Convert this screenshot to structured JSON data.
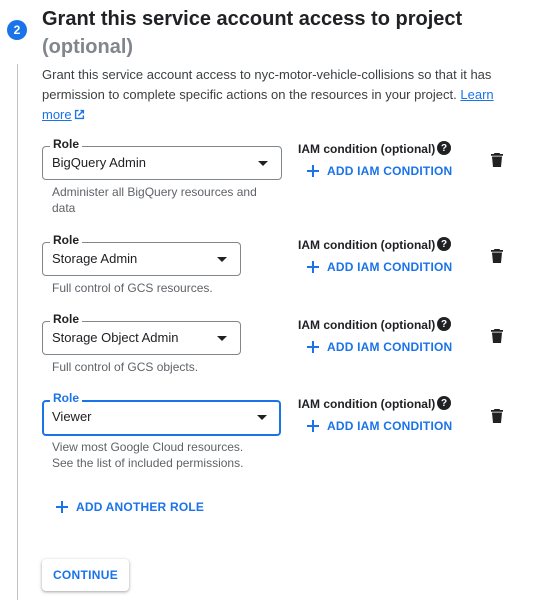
{
  "step": {
    "number": "2",
    "title_main": "Grant this service account access to project",
    "title_optional": "(optional)"
  },
  "description": {
    "text": "Grant this service account access to nyc-motor-vehicle-collisions so that it has permission to complete specific actions on the resources in your project.",
    "learn_more": "Learn more",
    "learn_more_icon": "external-link-icon"
  },
  "role_label": "Role",
  "iam_condition_label": "IAM condition (optional)",
  "add_iam_condition_label": "ADD IAM CONDITION",
  "roles": [
    {
      "value": "BigQuery Admin",
      "hint": "Administer all BigQuery resources and data"
    },
    {
      "value": "Storage Admin",
      "hint": "Full control of GCS resources."
    },
    {
      "value": "Storage Object Admin",
      "hint": "Full control of GCS objects."
    },
    {
      "value": "Viewer",
      "hint_line1": "View most Google Cloud resources.",
      "hint_line2": "See the list of included permissions."
    }
  ],
  "add_another_role": "ADD ANOTHER ROLE",
  "continue_button": "CONTINUE",
  "colors": {
    "accent": "#1a73e8",
    "text": "#202124",
    "muted": "#5f6368"
  },
  "icons": {
    "help": "help-circle-icon",
    "delete": "trash-icon",
    "dropdown": "caret-down-icon",
    "add": "plus-icon"
  }
}
